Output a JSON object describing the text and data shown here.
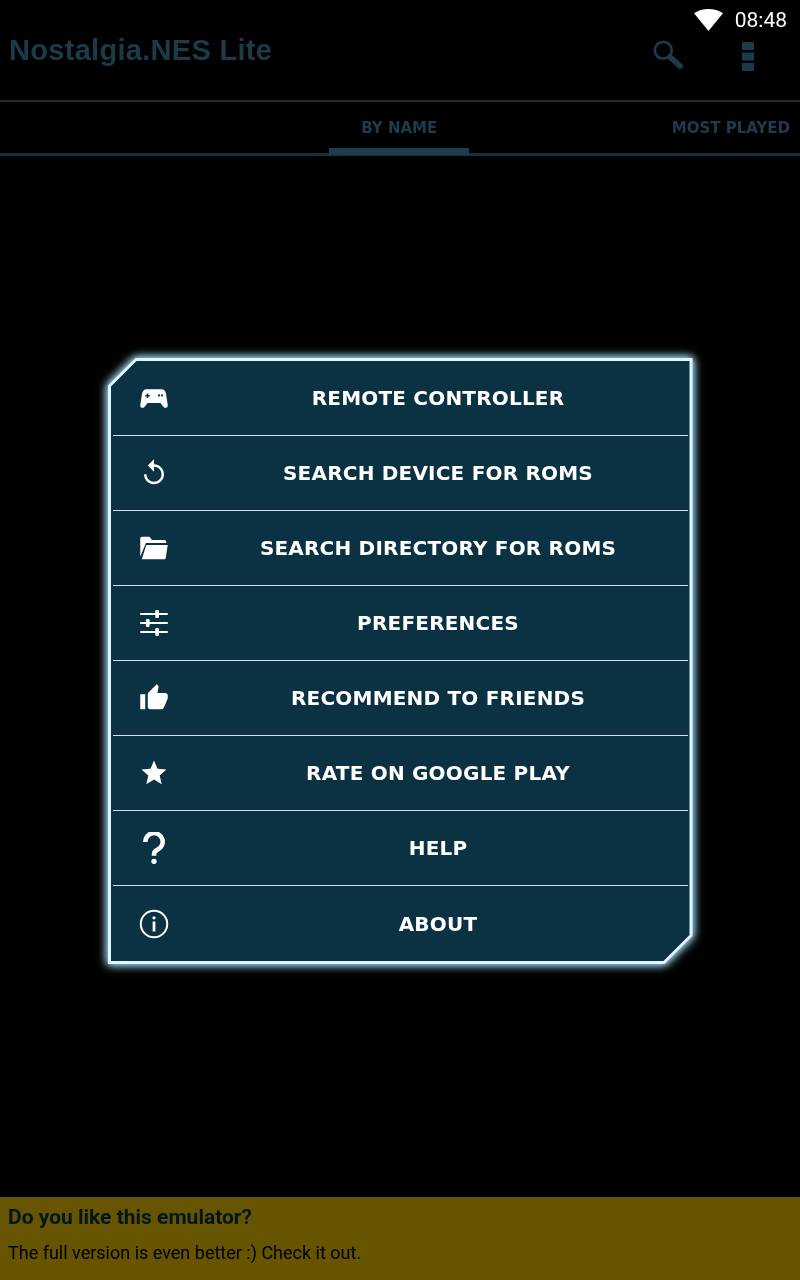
{
  "status_bar": {
    "time": "08:48"
  },
  "action_bar": {
    "title": "Nostalgia.NES Lite"
  },
  "tabs": [
    {
      "label": "BY NAME",
      "selected": true
    },
    {
      "label": "MOST PLAYED",
      "selected": false
    }
  ],
  "menu": {
    "items": [
      {
        "label": "REMOTE CONTROLLER"
      },
      {
        "label": "SEARCH DEVICE FOR ROMS"
      },
      {
        "label": "SEARCH DIRECTORY FOR ROMS"
      },
      {
        "label": "PREFERENCES"
      },
      {
        "label": "RECOMMEND TO FRIENDS"
      },
      {
        "label": "RATE ON GOOGLE PLAY"
      },
      {
        "label": "HELP"
      },
      {
        "label": "ABOUT"
      }
    ]
  },
  "banner": {
    "title": "Do you like this emulator?",
    "text": "The full version is even better :) Check it out."
  }
}
